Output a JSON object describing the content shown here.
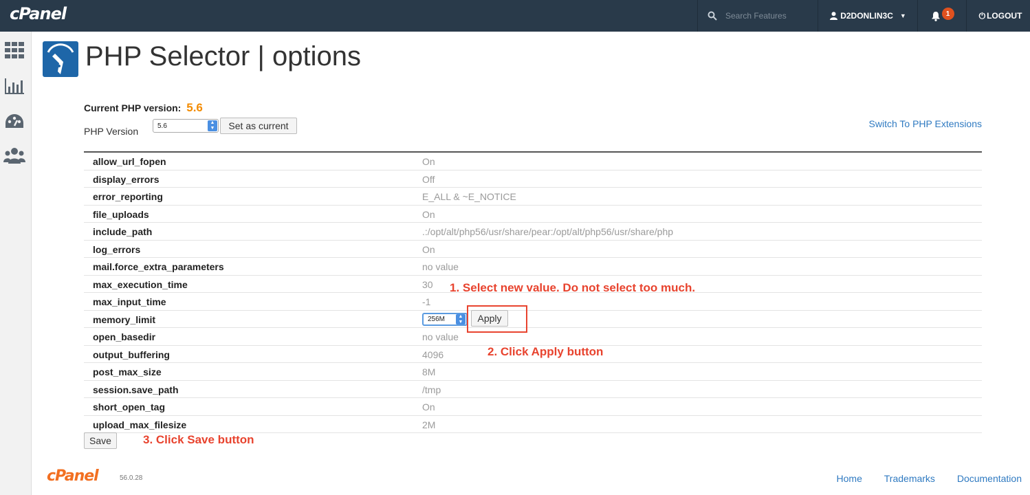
{
  "topbar": {
    "brand": "cPanel",
    "search_placeholder": "Search Features",
    "username": "D2DONLIN3C",
    "notification_count": "1",
    "logout_label": "LOGOUT"
  },
  "page": {
    "title": "PHP Selector | options",
    "current_version_label": "Current PHP version:",
    "current_version_value": "5.6",
    "version_label": "PHP Version",
    "version_selected": "5.6",
    "set_current_label": "Set as current",
    "switch_link": "Switch To PHP Extensions"
  },
  "options": [
    {
      "key": "allow_url_fopen",
      "value": "On"
    },
    {
      "key": "display_errors",
      "value": "Off"
    },
    {
      "key": "error_reporting",
      "value": "E_ALL & ~E_NOTICE"
    },
    {
      "key": "file_uploads",
      "value": "On"
    },
    {
      "key": "include_path",
      "value": ".:/opt/alt/php56/usr/share/pear:/opt/alt/php56/usr/share/php"
    },
    {
      "key": "log_errors",
      "value": "On"
    },
    {
      "key": "mail.force_extra_parameters",
      "value": "no value"
    },
    {
      "key": "max_execution_time",
      "value": "30"
    },
    {
      "key": "max_input_time",
      "value": "-1"
    },
    {
      "key": "memory_limit",
      "value": "256M"
    },
    {
      "key": "open_basedir",
      "value": "no value"
    },
    {
      "key": "output_buffering",
      "value": "4096"
    },
    {
      "key": "post_max_size",
      "value": "8M"
    },
    {
      "key": "session.save_path",
      "value": "/tmp"
    },
    {
      "key": "short_open_tag",
      "value": "On"
    },
    {
      "key": "upload_max_filesize",
      "value": "2M"
    }
  ],
  "apply_label": "Apply",
  "save_label": "Save",
  "annotations": {
    "step1": "1. Select new value. Do not select too much.",
    "step2": "2. Click Apply button",
    "step3": "3. Click Save button"
  },
  "footer": {
    "brand": "cPanel",
    "version": "56.0.28",
    "links": [
      "Home",
      "Trademarks",
      "Documentation"
    ]
  },
  "colors": {
    "topbar": "#293a4a",
    "accent_orange": "#f38b00",
    "link_blue": "#2f7ac1",
    "annotation_red": "#e8432e"
  }
}
